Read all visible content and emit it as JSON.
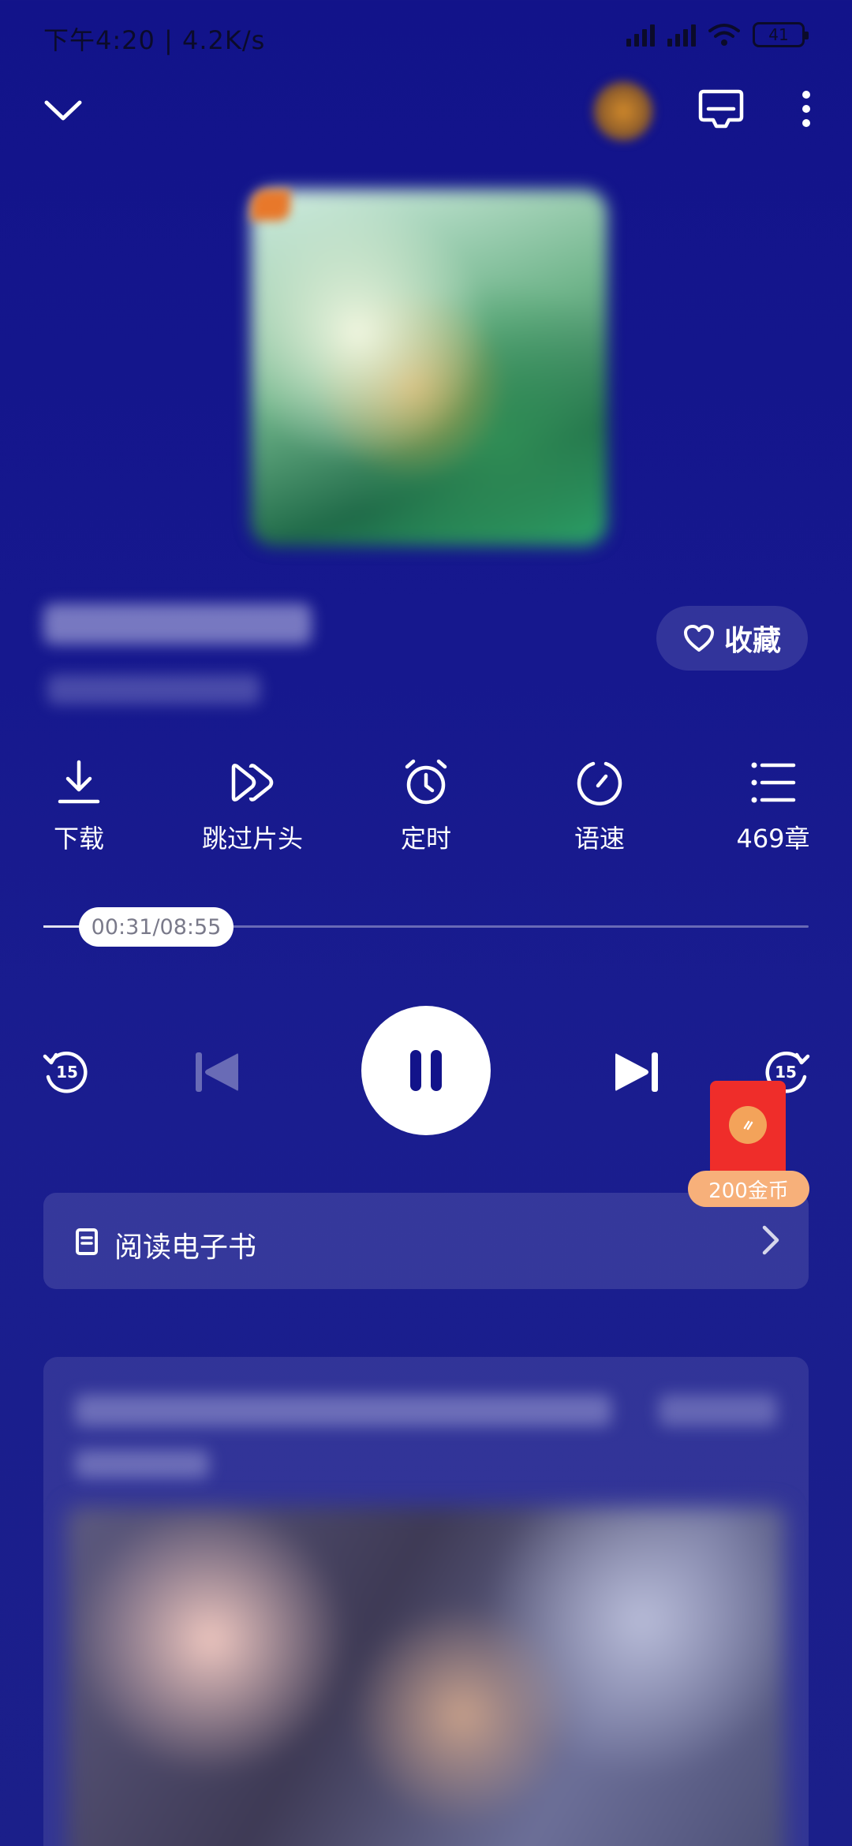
{
  "status_bar": {
    "time": "下午4:20 | 4.2K/s",
    "battery": "41"
  },
  "header": {
    "collapse_icon": "chevron-down-icon",
    "cast_icon": "cast-icon",
    "more_icon": "more-vertical-icon"
  },
  "favorite": {
    "label": "收藏",
    "icon": "heart-icon"
  },
  "actions": [
    {
      "label": "下载",
      "icon": "download-icon"
    },
    {
      "label": "跳过片头",
      "icon": "skip-intro-icon"
    },
    {
      "label": "定时",
      "icon": "alarm-clock-icon"
    },
    {
      "label": "语速",
      "icon": "speed-icon"
    },
    {
      "label": "469章",
      "icon": "chapter-list-icon"
    }
  ],
  "progress": {
    "time_label": "00:31/08:55",
    "fraction": 0.058
  },
  "controls": {
    "rewind_seconds": "15",
    "forward_seconds": "15"
  },
  "red_packet": {
    "label": "200金币"
  },
  "read_ebook": {
    "label": "阅读电子书"
  },
  "colors": {
    "background": "#14168c",
    "red_packet": "#ef2d2a",
    "coin_label": "#f7b07a"
  }
}
